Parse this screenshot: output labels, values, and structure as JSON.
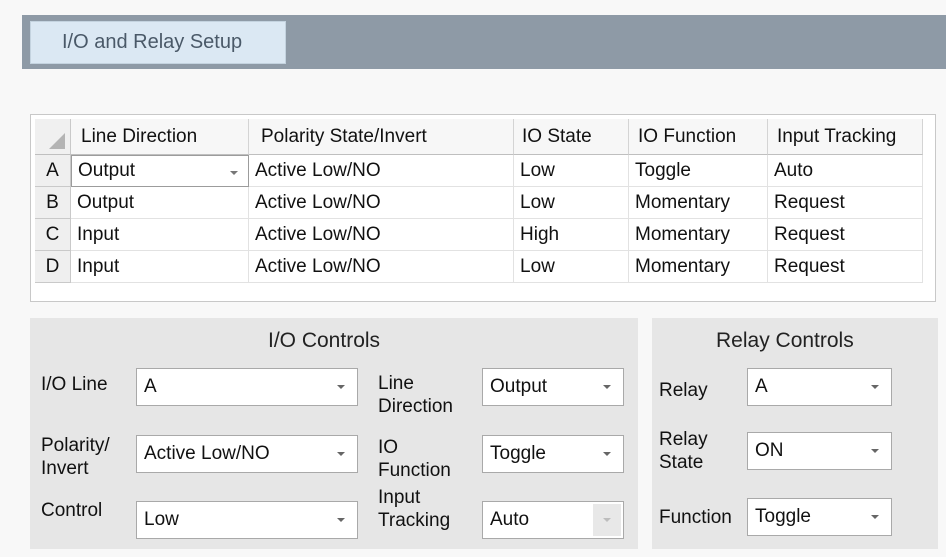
{
  "tab_label": "I/O and Relay Setup",
  "grid": {
    "columns": [
      "Line Direction",
      "Polarity State/Invert",
      "IO State",
      "IO Function",
      "Input Tracking"
    ],
    "rows": [
      {
        "id": "A",
        "cells": [
          "Output",
          "Active Low/NO",
          "Low",
          "Toggle",
          "Auto"
        ]
      },
      {
        "id": "B",
        "cells": [
          "Output",
          "Active Low/NO",
          "Low",
          "Momentary",
          "Request"
        ]
      },
      {
        "id": "C",
        "cells": [
          "Input",
          "Active Low/NO",
          "High",
          "Momentary",
          "Request"
        ]
      },
      {
        "id": "D",
        "cells": [
          "Input",
          "Active Low/NO",
          "Low",
          "Momentary",
          "Request"
        ]
      }
    ]
  },
  "io_controls": {
    "title": "I/O Controls",
    "io_line": {
      "label": "I/O Line",
      "value": "A"
    },
    "polarity": {
      "label_line1": "Polarity/",
      "label_line2": "Invert",
      "value": "Active Low/NO"
    },
    "control": {
      "label": "Control",
      "value": "Low"
    },
    "line_direction": {
      "label_line1": "Line",
      "label_line2": "Direction",
      "value": "Output"
    },
    "io_function": {
      "label_line1": "IO",
      "label_line2": "Function",
      "value": "Toggle"
    },
    "input_tracking": {
      "label_line1": "Input",
      "label_line2": "Tracking",
      "value": "Auto"
    }
  },
  "relay_controls": {
    "title": "Relay Controls",
    "relay": {
      "label": "Relay",
      "value": "A"
    },
    "relay_state": {
      "label_line1": "Relay",
      "label_line2": "State",
      "value": "ON"
    },
    "function": {
      "label": "Function",
      "value": "Toggle"
    }
  }
}
